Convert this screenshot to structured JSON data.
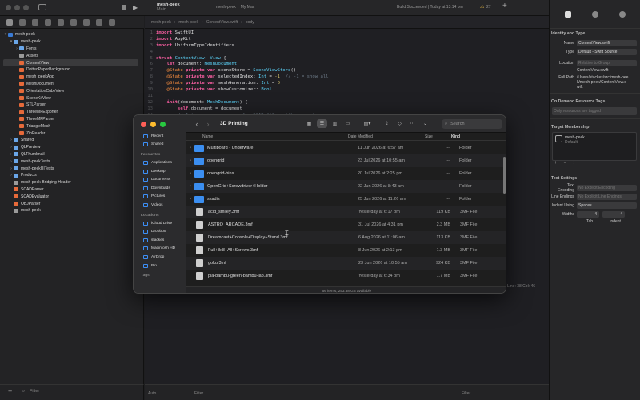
{
  "xcode": {
    "scheme": "mesh-peek",
    "scheme_sub": "Main",
    "run_dest": "mesh-peek",
    "run_dest_device": "My Mac",
    "build_status": "Build Succeeded | Today at 13:14 pm",
    "warning_count": "27",
    "jumpbar": [
      "mesh-peek",
      "mesh-peek",
      "ContentView.swift",
      "body"
    ],
    "navigator": [
      {
        "label": "mesh-peek",
        "indent": 0,
        "disc": "▾",
        "icon": "proj",
        "sel": false
      },
      {
        "label": "mesh-peek",
        "indent": 1,
        "disc": "▾",
        "icon": "fold",
        "sel": false
      },
      {
        "label": "Fonts",
        "indent": 2,
        "disc": "›",
        "icon": "fold",
        "sel": false
      },
      {
        "label": "Assets",
        "indent": 2,
        "disc": "",
        "icon": "file",
        "sel": false
      },
      {
        "label": "ContentView",
        "indent": 2,
        "disc": "",
        "icon": "swift",
        "sel": true
      },
      {
        "label": "DottedPaperBackground",
        "indent": 2,
        "disc": "",
        "icon": "swift",
        "sel": false
      },
      {
        "label": "mesh_peekApp",
        "indent": 2,
        "disc": "",
        "icon": "swift",
        "sel": false
      },
      {
        "label": "MeshDocument",
        "indent": 2,
        "disc": "",
        "icon": "swift",
        "sel": false
      },
      {
        "label": "OrientationCubeView",
        "indent": 2,
        "disc": "",
        "icon": "swift",
        "sel": false
      },
      {
        "label": "SceneKitView",
        "indent": 2,
        "disc": "",
        "icon": "swift",
        "sel": false
      },
      {
        "label": "STLParser",
        "indent": 2,
        "disc": "",
        "icon": "swift",
        "sel": false
      },
      {
        "label": "ThreeMFExporter",
        "indent": 2,
        "disc": "",
        "icon": "swift",
        "sel": false
      },
      {
        "label": "ThreeMFParser",
        "indent": 2,
        "disc": "",
        "icon": "swift",
        "sel": false
      },
      {
        "label": "TriangleMesh",
        "indent": 2,
        "disc": "",
        "icon": "swift",
        "sel": false
      },
      {
        "label": "ZipReader",
        "indent": 2,
        "disc": "",
        "icon": "swift",
        "sel": false
      },
      {
        "label": "Shared",
        "indent": 1,
        "disc": "›",
        "icon": "fold",
        "sel": false
      },
      {
        "label": "QLPreview",
        "indent": 1,
        "disc": "›",
        "icon": "fold",
        "sel": false
      },
      {
        "label": "QLThumbnail",
        "indent": 1,
        "disc": "›",
        "icon": "fold",
        "sel": false
      },
      {
        "label": "mesh-peekTests",
        "indent": 1,
        "disc": "›",
        "icon": "fold",
        "sel": false
      },
      {
        "label": "mesh-peekUITests",
        "indent": 1,
        "disc": "›",
        "icon": "fold",
        "sel": false
      },
      {
        "label": "Products",
        "indent": 1,
        "disc": "›",
        "icon": "fold",
        "sel": false
      },
      {
        "label": "mesh-peek-Bridging-Header",
        "indent": 1,
        "disc": "",
        "icon": "file",
        "sel": false
      },
      {
        "label": "SCADParser",
        "indent": 1,
        "disc": "",
        "icon": "swift",
        "sel": false
      },
      {
        "label": "SCADEvaluator",
        "indent": 1,
        "disc": "",
        "icon": "swift",
        "sel": false
      },
      {
        "label": "OBJParser",
        "indent": 1,
        "disc": "",
        "icon": "swift",
        "sel": false
      },
      {
        "label": "mesh-peek",
        "indent": 1,
        "disc": "",
        "icon": "file",
        "sel": false
      }
    ],
    "filter_placeholder": "Filter",
    "editor_filter_placeholder": "Filter",
    "auto_label": "Auto",
    "position": "Line: 38  Col: 46"
  },
  "inspector": {
    "identity_title": "Identity and Type",
    "name_label": "Name",
    "name_value": "ContentView.swift",
    "type_label": "Type",
    "type_value": "Default - Swift Source",
    "location_label": "Location",
    "location_value": "Relative to Group",
    "location_file": "ContentView.swift",
    "fullpath_label": "Full Path",
    "fullpath_value": "/Users/stackes/src/mesh-peek/mesh-peek/ContentView.swift",
    "odr_title": "On Demand Resource Tags",
    "odr_placeholder": "Only resources are tagged",
    "target_title": "Target Membership",
    "target_name": "mesh-peek",
    "target_sub": "Default",
    "text_title": "Text Settings",
    "encoding_label": "Text Encoding",
    "encoding_value": "No Explicit Encoding",
    "line_label": "Line Endings",
    "line_value": "No Explicit Line Endings",
    "indent_label": "Indent Using",
    "indent_value": "Spaces",
    "widths_label": "Widths",
    "tab_value": "4",
    "indent_num": "4",
    "tab_label": "Tab",
    "indent_sub": "Indent"
  },
  "code": [
    {
      "n": "1",
      "parts": [
        [
          "kw",
          "import "
        ],
        [
          "pl",
          "SwiftUI"
        ]
      ]
    },
    {
      "n": "2",
      "parts": [
        [
          "kw",
          "import "
        ],
        [
          "pl",
          "AppKit"
        ]
      ]
    },
    {
      "n": "3",
      "parts": [
        [
          "kw",
          "import "
        ],
        [
          "pl",
          "UniformTypeIdentifiers"
        ]
      ]
    },
    {
      "n": "4",
      "parts": []
    },
    {
      "n": "5",
      "parts": [
        [
          "kw",
          "struct "
        ],
        [
          "ty",
          "ContentView"
        ],
        [
          "pl",
          ": "
        ],
        [
          "ty",
          "View"
        ],
        [
          "pl",
          " {"
        ]
      ]
    },
    {
      "n": "6",
      "parts": [
        [
          "pl",
          "    "
        ],
        [
          "kw",
          "let "
        ],
        [
          "pl",
          "document: "
        ],
        [
          "ty",
          "MeshDocument"
        ]
      ]
    },
    {
      "n": "7",
      "parts": [
        [
          "pl",
          "    "
        ],
        [
          "at",
          "@State "
        ],
        [
          "kw",
          "private var "
        ],
        [
          "pl",
          "sceneStore = "
        ],
        [
          "ty",
          "SceneViewStore"
        ],
        [
          "pl",
          "()"
        ]
      ]
    },
    {
      "n": "8",
      "parts": [
        [
          "pl",
          "    "
        ],
        [
          "at",
          "@State "
        ],
        [
          "kw",
          "private var "
        ],
        [
          "pl",
          "selectedIndex: "
        ],
        [
          "ty",
          "Int"
        ],
        [
          "pl",
          " = "
        ],
        [
          "nm",
          "-1"
        ],
        [
          "cm",
          "  // -1 = show all"
        ]
      ]
    },
    {
      "n": "9",
      "parts": [
        [
          "pl",
          "    "
        ],
        [
          "at",
          "@State "
        ],
        [
          "kw",
          "private var "
        ],
        [
          "pl",
          "meshGeneration: "
        ],
        [
          "ty",
          "Int"
        ],
        [
          "pl",
          " = "
        ],
        [
          "nm",
          "0"
        ]
      ]
    },
    {
      "n": "10",
      "parts": [
        [
          "pl",
          "    "
        ],
        [
          "at",
          "@State "
        ],
        [
          "kw",
          "private var "
        ],
        [
          "pl",
          "showCustomizer: "
        ],
        [
          "ty",
          "Bool"
        ]
      ]
    },
    {
      "n": "11",
      "parts": []
    },
    {
      "n": "12",
      "parts": [
        [
          "pl",
          "    "
        ],
        [
          "kw",
          "init"
        ],
        [
          "pl",
          "(document: "
        ],
        [
          "ty",
          "MeshDocument"
        ],
        [
          "pl",
          ") {"
        ]
      ]
    },
    {
      "n": "13",
      "parts": [
        [
          "pl",
          "        "
        ],
        [
          "kw",
          "self"
        ],
        [
          "pl",
          ".document = document"
        ]
      ]
    },
    {
      "n": "14",
      "parts": [
        [
          "cm",
          "        // Auto-open customizer for SCAD files with parameters"
        ]
      ]
    }
  ],
  "finder": {
    "title": "3D Printing",
    "search_placeholder": "Search",
    "favorites": [
      {
        "label": "Recent",
        "icon": "clock-icon"
      },
      {
        "label": "Shared",
        "icon": "shared-icon"
      }
    ],
    "favorites_title": "Favourites",
    "favorite_items": [
      {
        "label": "Applications",
        "icon": "applications-icon"
      },
      {
        "label": "Desktop",
        "icon": "desktop-icon"
      },
      {
        "label": "Documents",
        "icon": "documents-icon"
      },
      {
        "label": "Downloads",
        "icon": "downloads-icon"
      },
      {
        "label": "Pictures",
        "icon": "pictures-icon"
      },
      {
        "label": "Videos",
        "icon": "videos-icon"
      }
    ],
    "locations_title": "Locations",
    "locations": [
      {
        "label": "iCloud Drive",
        "icon": "icloud-icon"
      },
      {
        "label": "Dropbox",
        "icon": "dropbox-icon"
      },
      {
        "label": "stackes",
        "icon": "home-icon"
      },
      {
        "label": "Macintosh HD",
        "icon": "disk-icon"
      },
      {
        "label": "AirDrop",
        "icon": "airdrop-icon"
      },
      {
        "label": "Bin",
        "icon": "bin-icon"
      }
    ],
    "tags_title": "Tags",
    "columns": {
      "name": "Name",
      "date": "Date Modified",
      "size": "Size",
      "kind": "Kind"
    },
    "rows": [
      {
        "name": "Multiboard - Underware",
        "date": "11 Jun 2026 at 6:57 am",
        "size": "--",
        "kind": "Folder",
        "type": "folder"
      },
      {
        "name": "opengrid",
        "date": "23 Jul 2026 at 10:55 am",
        "size": "--",
        "kind": "Folder",
        "type": "folder"
      },
      {
        "name": "opengrid-bins",
        "date": "20 Jul 2026 at 2:25 pm",
        "size": "--",
        "kind": "Folder",
        "type": "folder"
      },
      {
        "name": "OpenGrid+Screwdriver+Holder",
        "date": "22 Jun 2026 at 8:43 am",
        "size": "--",
        "kind": "Folder",
        "type": "folder"
      },
      {
        "name": "skadis",
        "date": "25 Jun 2026 at 11:26 am",
        "size": "--",
        "kind": "Folder",
        "type": "folder"
      },
      {
        "name": "acid_smiley.3mf",
        "date": "Yesterday at 6:17 pm",
        "size": "119 KB",
        "kind": "3MF File",
        "type": "doc"
      },
      {
        "name": "ASTRO_ARCADE.3mf",
        "date": "31 Jul 2026 at 4:31 pm",
        "size": "2.3 MB",
        "kind": "3MF File",
        "type": "doc"
      },
      {
        "name": "Dreamcast+Console+Display+Stand.3mf",
        "date": "6 Aug 2026 at 11:06 am",
        "size": "113 KB",
        "kind": "3MF File",
        "type": "doc"
      },
      {
        "name": "Full+8x8+All+Screws.3mf",
        "date": "8 Jun 2026 at 2:13 pm",
        "size": "1.3 MB",
        "kind": "3MF File",
        "type": "doc"
      },
      {
        "name": "goku.3mf",
        "date": "23 Jun 2026 at 10:55 am",
        "size": "924 KB",
        "kind": "3MF File",
        "type": "doc"
      },
      {
        "name": "pla-bambu-green-bambu-lab.3mf",
        "date": "Yesterday at 6:34 pm",
        "size": "1.7 MB",
        "kind": "3MF File",
        "type": "doc"
      }
    ],
    "status": "56 items, 253.38 GB available"
  }
}
